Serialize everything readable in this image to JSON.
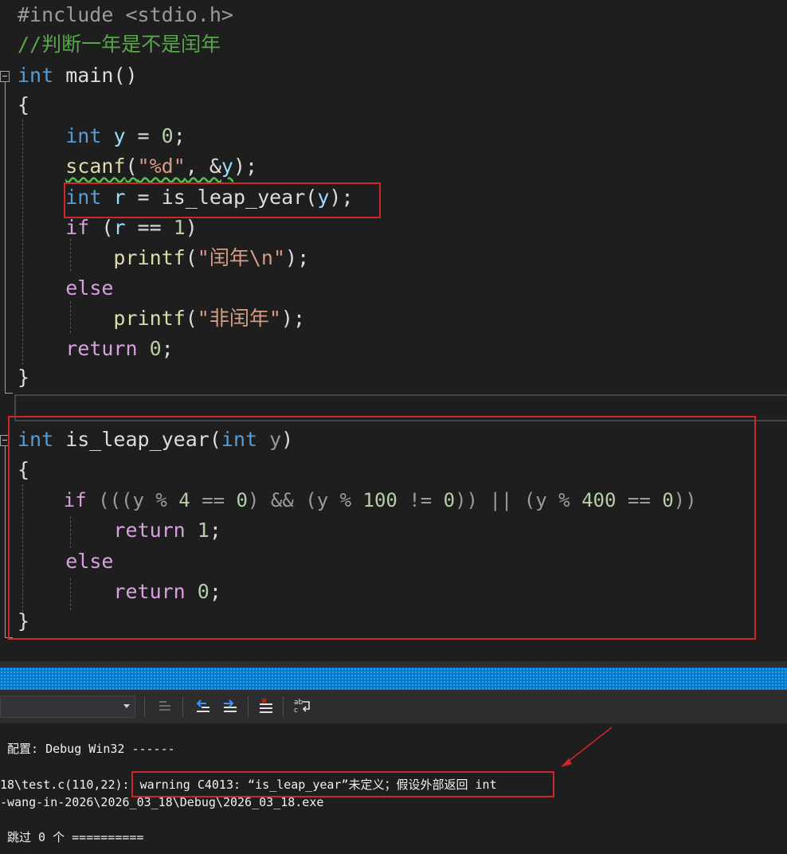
{
  "editor": {
    "line_include": "#include <stdio.h>",
    "line_comment": "//判断一年是不是闰年",
    "main": {
      "ret_type": "int",
      "name": "main",
      "parens": "()",
      "open_brace": "{",
      "decl_type": "int",
      "decl_var": "y",
      "decl_rest": " = ",
      "decl_num": "0",
      "decl_end": ";",
      "scanf_fn": "scanf",
      "scanf_open": "(",
      "scanf_str": "\"%d\"",
      "scanf_sep": ", &",
      "scanf_var": "y",
      "scanf_end": ");",
      "r_type": "int",
      "r_var": "r",
      "r_eq": " = ",
      "r_call": "is_leap_year",
      "r_open": "(",
      "r_arg": "y",
      "r_end": ");",
      "if_kw": "if",
      "if_open": " (",
      "if_var": "r",
      "if_op": " == ",
      "if_num": "1",
      "if_close": ")",
      "printf1_fn": "printf",
      "printf1_open": "(",
      "printf1_str": "\"闰年\\n\"",
      "printf1_end": ");",
      "else_kw": "else",
      "printf2_fn": "printf",
      "printf2_open": "(",
      "printf2_str": "\"非闰年\"",
      "printf2_end": ");",
      "return_kw": "return",
      "return_num": " 0",
      "return_end": ";",
      "close_brace": "}"
    },
    "leap": {
      "ret_type": "int",
      "name": " is_leap_year",
      "open": "(",
      "param_type": "int",
      "param_name": " y",
      "close": ")",
      "open_brace": "{",
      "if_kw": "if",
      "cond_a": " (((y % ",
      "n4": "4",
      "cond_b": " == ",
      "z1": "0",
      "cond_c": ") && (y % ",
      "n100": "100",
      "cond_d": " != ",
      "z2": "0",
      "cond_e": ")) || (y % ",
      "n400": "400",
      "cond_f": " == ",
      "z3": "0",
      "cond_g": "))",
      "return1_kw": "return",
      "return1_num": " 1",
      "return1_end": ";",
      "else_kw": "else",
      "return0_kw": "return",
      "return0_num": " 0",
      "return0_end": ";",
      "close_brace": "}"
    }
  },
  "output": {
    "line1": " 配置: Debug Win32 ------",
    "line2_prefix": "18\\test.c(110,22): ",
    "line2_warning": "warning C4013: “is_leap_year”未定义；假设外部返回 int",
    "line3": "-wang-in-2026\\2026_03_18\\Debug\\2026_03_18.exe",
    "line4": " 跳过 0 个 =========="
  },
  "icons": [
    "align-left-icon",
    "previous-message-icon",
    "next-message-icon",
    "clear-all-icon",
    "word-wrap-icon"
  ],
  "colors": {
    "annotation_red": "#d0262b",
    "title_blue": "#007acc"
  }
}
